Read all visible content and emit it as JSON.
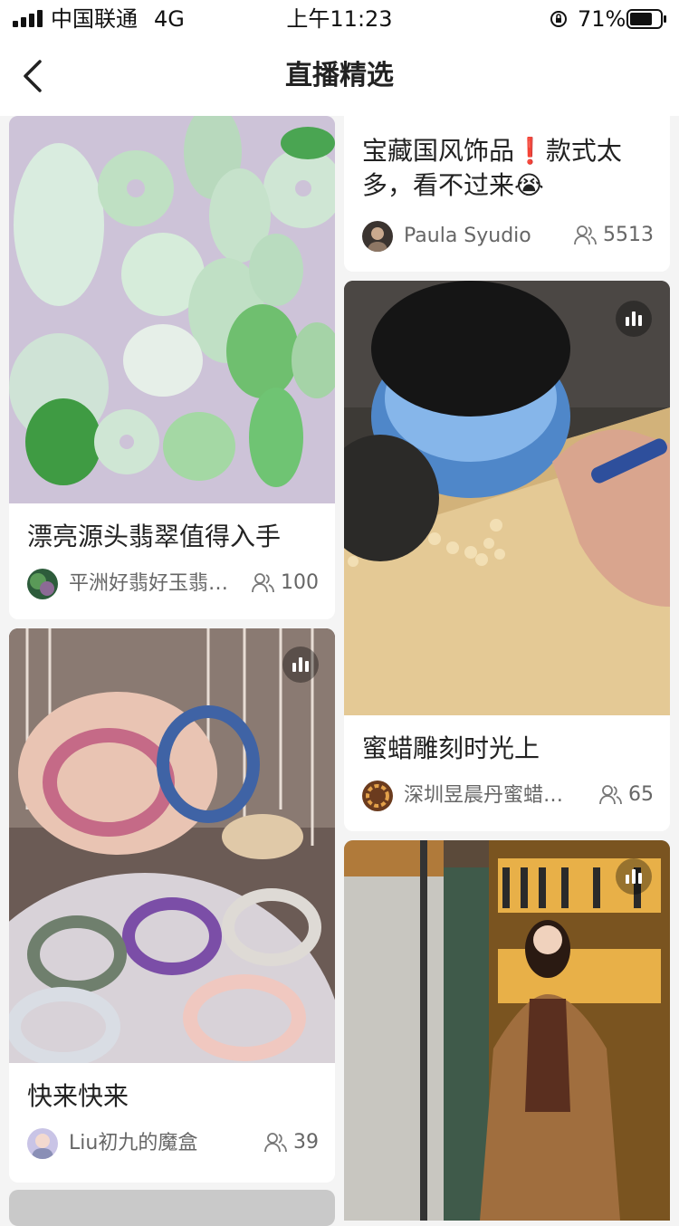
{
  "status": {
    "carrier": "中国联通",
    "network": "4G",
    "time": "上午11:23",
    "battery": "71%"
  },
  "nav": {
    "title": "直播精选"
  },
  "cards": [
    {
      "title": "漂亮源头翡翠值得入手",
      "author": "平洲好翡好玉翡…",
      "viewers": "100"
    },
    {
      "title": "快来快来",
      "author": "Liu初九的魔盒",
      "viewers": "39"
    },
    {
      "title": "宝藏国风饰品❗️款式太多，看不过来😭",
      "author": "Paula Syudio",
      "viewers": "5513"
    },
    {
      "title": "蜜蜡雕刻时光上",
      "author": "深圳昱晨丹蜜蜡…",
      "viewers": "65"
    }
  ],
  "icons": [
    "back-chevron-icon",
    "signal-icon",
    "orientation-lock-icon",
    "battery-icon",
    "live-bars-icon",
    "viewers-icon"
  ],
  "colors": {
    "background": "#f4f4f4",
    "card": "#ffffff",
    "text": "#222222",
    "meta": "#666666"
  }
}
